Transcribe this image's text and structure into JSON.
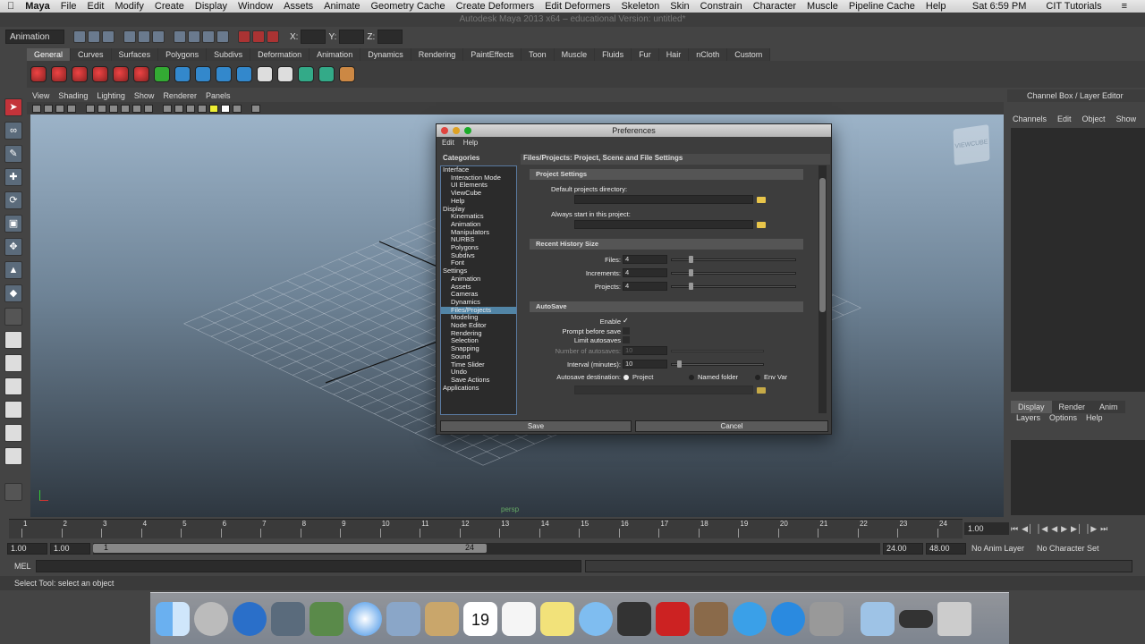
{
  "menubar": {
    "apple": "",
    "app": "Maya",
    "items": [
      "File",
      "Edit",
      "Modify",
      "Create",
      "Display",
      "Window",
      "Assets",
      "Animate",
      "Geometry Cache",
      "Create Deformers",
      "Edit Deformers",
      "Skeleton",
      "Skin",
      "Constrain",
      "Character",
      "Muscle",
      "Pipeline Cache",
      "Help"
    ],
    "clock": "Sat 6:59 PM",
    "user": "CIT Tutorials"
  },
  "maya_title": "Autodesk Maya 2013 x64 – educational Version: untitled*",
  "status": {
    "mode": "Animation",
    "x_label": "X:",
    "y_label": "Y:",
    "z_label": "Z:"
  },
  "shelf_tabs": [
    "General",
    "Curves",
    "Surfaces",
    "Polygons",
    "Subdivs",
    "Deformation",
    "Animation",
    "Dynamics",
    "Rendering",
    "PaintEffects",
    "Toon",
    "Muscle",
    "Fluids",
    "Fur",
    "Hair",
    "nCloth",
    "Custom"
  ],
  "panel_menu": [
    "View",
    "Shading",
    "Lighting",
    "Show",
    "Renderer",
    "Panels"
  ],
  "viewport": {
    "camera": "persp"
  },
  "channel_box": {
    "title": "Channel Box / Layer Editor",
    "menu": [
      "Channels",
      "Edit",
      "Object",
      "Show"
    ]
  },
  "layer_editor": {
    "tabs": [
      "Display",
      "Render",
      "Anim"
    ],
    "menu": [
      "Layers",
      "Options",
      "Help"
    ]
  },
  "timeline": {
    "ticks": [
      "1",
      "2",
      "3",
      "4",
      "5",
      "6",
      "7",
      "8",
      "9",
      "10",
      "11",
      "12",
      "13",
      "14",
      "15",
      "16",
      "17",
      "18",
      "19",
      "20",
      "21",
      "22",
      "23",
      "24"
    ],
    "current_frame": "1.00"
  },
  "range": {
    "start": "1.00",
    "anim_start": "1.00",
    "range_start": "1",
    "range_end": "24",
    "anim_end": "24.00",
    "end": "48.00",
    "anim_layer": "No Anim Layer",
    "character_set": "No Character Set"
  },
  "command_line": {
    "label": "MEL"
  },
  "help_line": "Select Tool: select an object",
  "preferences": {
    "title": "Preferences",
    "menu": [
      "Edit",
      "Help"
    ],
    "categories_header": "Categories",
    "settings_header": "Files/Projects: Project, Scene and File Settings",
    "categories": [
      {
        "label": "Interface",
        "level": 0
      },
      {
        "label": "Interaction Mode",
        "level": 1
      },
      {
        "label": "UI Elements",
        "level": 1
      },
      {
        "label": "ViewCube",
        "level": 1
      },
      {
        "label": "Help",
        "level": 1
      },
      {
        "label": "Display",
        "level": 0
      },
      {
        "label": "Kinematics",
        "level": 1
      },
      {
        "label": "Animation",
        "level": 1
      },
      {
        "label": "Manipulators",
        "level": 1
      },
      {
        "label": "NURBS",
        "level": 1
      },
      {
        "label": "Polygons",
        "level": 1
      },
      {
        "label": "Subdivs",
        "level": 1
      },
      {
        "label": "Font",
        "level": 1
      },
      {
        "label": "Settings",
        "level": 0
      },
      {
        "label": "Animation",
        "level": 1
      },
      {
        "label": "Assets",
        "level": 1
      },
      {
        "label": "Cameras",
        "level": 1
      },
      {
        "label": "Dynamics",
        "level": 1
      },
      {
        "label": "Files/Projects",
        "level": 1,
        "selected": true
      },
      {
        "label": "Modeling",
        "level": 1
      },
      {
        "label": "Node Editor",
        "level": 1
      },
      {
        "label": "Rendering",
        "level": 1
      },
      {
        "label": "Selection",
        "level": 1
      },
      {
        "label": "Snapping",
        "level": 1
      },
      {
        "label": "Sound",
        "level": 1
      },
      {
        "label": "Time Slider",
        "level": 1
      },
      {
        "label": "Undo",
        "level": 1
      },
      {
        "label": "Save Actions",
        "level": 1
      },
      {
        "label": "Applications",
        "level": 0
      }
    ],
    "project_settings": {
      "header": "Project Settings",
      "default_dir_label": "Default projects directory:",
      "always_start_label": "Always start in this project:"
    },
    "recent_history": {
      "header": "Recent History Size",
      "files_label": "Files:",
      "files_value": "4",
      "increments_label": "Increments:",
      "increments_value": "4",
      "projects_label": "Projects:",
      "projects_value": "4"
    },
    "autosave": {
      "header": "AutoSave",
      "enable_label": "Enable",
      "enable_mark": "✓",
      "prompt_label": "Prompt before save",
      "limit_label": "Limit autosaves",
      "number_label": "Number of autosaves:",
      "number_value": "10",
      "interval_label": "Interval (minutes):",
      "interval_value": "10",
      "destination_label": "Autosave destination:",
      "options": [
        "Project",
        "Named folder",
        "Env Var"
      ]
    },
    "save_label": "Save",
    "cancel_label": "Cancel"
  }
}
